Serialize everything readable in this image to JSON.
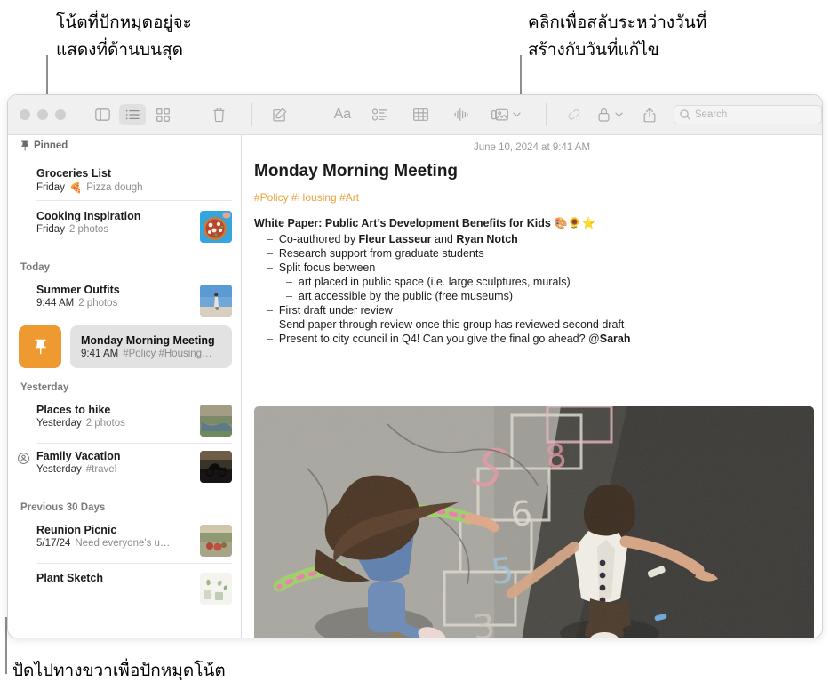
{
  "annotations": {
    "top_left": "โน้ตที่ปักหมุดอยู่จะ\nแสดงที่ด้านบนสุด",
    "top_right": "คลิกเพื่อสลับระหว่างวันที่\nสร้างกับวันที่แก้ไข",
    "bottom_left": "ปัดไปทางขวาเพื่อปักหมุดโน้ต"
  },
  "toolbar": {
    "sidebar_toggle": "sidebar-icon",
    "list_view": "list-view-icon",
    "gallery_view": "gallery-view-icon",
    "delete": "trash-icon",
    "compose": "compose-icon",
    "format": "Aa",
    "checklist": "checklist-icon",
    "table": "table-icon",
    "audio": "audio-icon",
    "media": "media-icon",
    "collaborate": "collaborate-icon",
    "lock": "lock-icon",
    "share": "share-icon",
    "search_placeholder": "Search",
    "search_value": ""
  },
  "sidebar": {
    "pinned_header": "Pinned",
    "sections": [
      {
        "header": "Pinned",
        "notes": [
          {
            "title": "Groceries List",
            "date": "Friday",
            "preview": "Pizza dough",
            "preview_emoji": "🍕",
            "thumb": "none"
          },
          {
            "title": "Cooking Inspiration",
            "date": "Friday",
            "preview": "2 photos",
            "thumb": "pizza"
          }
        ]
      },
      {
        "header": "Today",
        "notes": [
          {
            "title": "Summer Outfits",
            "date": "9:44 AM",
            "preview": "2 photos",
            "thumb": "outfit"
          }
        ]
      },
      {
        "header": "Yesterday",
        "notes": [
          {
            "title": "Places to hike",
            "date": "Yesterday",
            "preview": "2 photos",
            "thumb": "hike"
          },
          {
            "title": "Family Vacation",
            "date": "Yesterday",
            "preview": "#travel",
            "thumb": "bike",
            "shared": true
          }
        ]
      },
      {
        "header": "Previous 30 Days",
        "notes": [
          {
            "title": "Reunion Picnic",
            "date": "5/17/24",
            "preview": "Need everyone's u…",
            "thumb": "picnic"
          },
          {
            "title": "Plant Sketch",
            "date": "",
            "preview": "",
            "thumb": "plant"
          }
        ]
      }
    ],
    "selected_note": {
      "title": "Monday Morning Meeting",
      "date": "9:41 AM",
      "preview": "#Policy #Housing…",
      "pin_action_icon": "pin-icon",
      "pin_action_color": "#ee9a31"
    }
  },
  "note": {
    "date": "June 10, 2024 at 9:41 AM",
    "title": "Monday Morning Meeting",
    "tags": "#Policy #Housing #Art",
    "tag_color": "#e8a33d",
    "body": [
      {
        "indent": 0,
        "bullet": false,
        "bold": true,
        "text": "White Paper: Public Art’s Development Benefits for Kids ",
        "emoji": "🎨🌻⭐"
      },
      {
        "indent": 1,
        "bullet": true,
        "text_parts": [
          "Co-authored by ",
          "Fleur Lasseur",
          " and ",
          "Ryan Notch"
        ]
      },
      {
        "indent": 1,
        "bullet": true,
        "text": "Research support from graduate students"
      },
      {
        "indent": 1,
        "bullet": true,
        "text": "Split focus between"
      },
      {
        "indent": 2,
        "bullet": true,
        "text": "art placed in public space (i.e. large sculptures, murals)"
      },
      {
        "indent": 2,
        "bullet": true,
        "text": "art accessible by the public (free museums)"
      },
      {
        "indent": 1,
        "bullet": true,
        "text": "First draft under review"
      },
      {
        "indent": 1,
        "bullet": true,
        "text": "Send paper through review once this group has reviewed second draft"
      },
      {
        "indent": 1,
        "bullet": true,
        "text_parts": [
          "Present to city council in Q4! Can you give the final go ahead? @",
          "Sarah"
        ]
      }
    ],
    "photo_alt": "two-children-playing-hopscotch-on-asphalt"
  }
}
